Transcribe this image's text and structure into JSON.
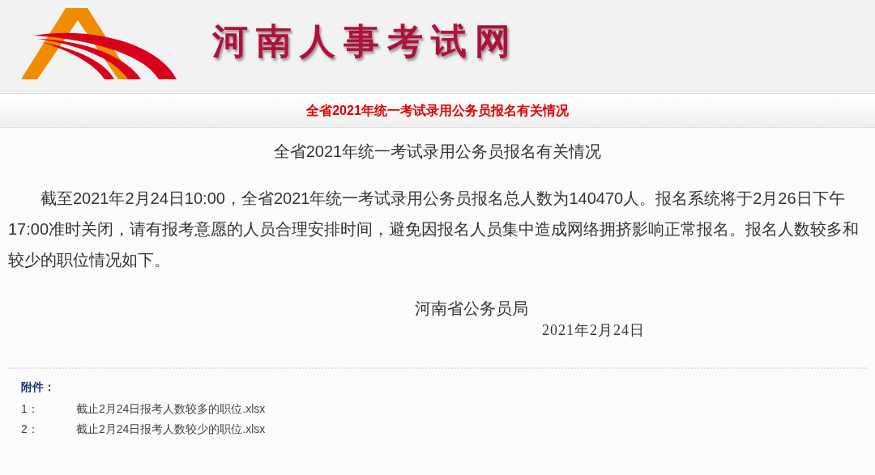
{
  "header": {
    "site_title": "河南人事考试网"
  },
  "banner": {
    "title": "全省2021年统一考试录用公务员报名有关情况"
  },
  "article": {
    "title": "全省2021年统一考试录用公务员报名有关情况",
    "body": "截至2021年2月24日10:00，全省2021年统一考试录用公务员报名总人数为140470人。报名系统将于2月26日下午17:00准时关闭，请有报考意愿的人员合理安排时间，避免因报名人员集中造成网络拥挤影响正常报名。报名人数较多和较少的职位情况如下。",
    "signature": "河南省公务员局",
    "date": "2021年2月24日"
  },
  "attachments": {
    "label": "附件：",
    "items": [
      {
        "index": "1：",
        "file": "截止2月24日报考人数较多的职位.xlsx"
      },
      {
        "index": "2：",
        "file": "截止2月24日报考人数较少的职位.xlsx"
      }
    ]
  }
}
